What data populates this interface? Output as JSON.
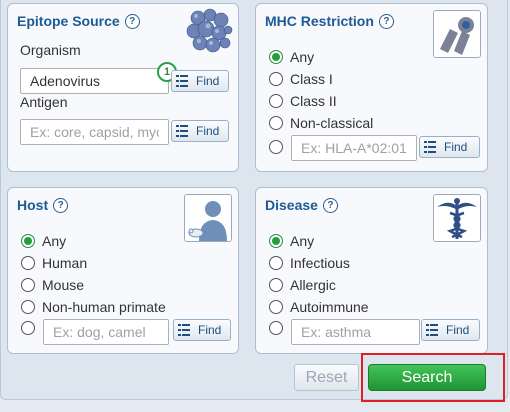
{
  "epitope_source": {
    "title": "Epitope Source",
    "help": "?",
    "organism_label": "Organism",
    "organism_value": "Adenovirus",
    "organism_badge": "1",
    "organism_find": "Find",
    "antigen_label": "Antigen",
    "antigen_placeholder": "Ex: core, capsid, myosin",
    "antigen_find": "Find",
    "icon": "protein-structure-icon"
  },
  "mhc_restriction": {
    "title": "MHC Restriction",
    "help": "?",
    "options": [
      "Any",
      "Class I",
      "Class II",
      "Non-classical"
    ],
    "selected": "Any",
    "custom_placeholder": "Ex: HLA-A*02:01",
    "find": "Find",
    "icon": "mhc-molecule-icon"
  },
  "host": {
    "title": "Host",
    "help": "?",
    "options": [
      "Any",
      "Human",
      "Mouse",
      "Non-human primate"
    ],
    "selected": "Any",
    "custom_placeholder": "Ex: dog, camel",
    "find": "Find",
    "icon": "human-mouse-icon"
  },
  "disease": {
    "title": "Disease",
    "help": "?",
    "options": [
      "Any",
      "Infectious",
      "Allergic",
      "Autoimmune"
    ],
    "selected": "Any",
    "custom_placeholder": "Ex: asthma",
    "find": "Find",
    "icon": "caduceus-icon"
  },
  "actions": {
    "reset_label": "Reset",
    "search_label": "Search"
  },
  "colors": {
    "title_blue": "#1e5a96",
    "search_green": "#2aa046",
    "highlight_red": "#e02020"
  }
}
